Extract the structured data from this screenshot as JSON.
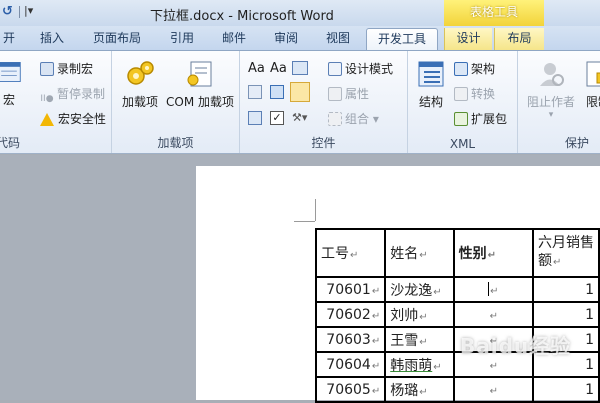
{
  "window": {
    "title": "下拉框.docx - Microsoft Word",
    "quick_access_more": "|▾",
    "context_group": "表格工具"
  },
  "tabs": [
    {
      "label": "开始"
    },
    {
      "label": "插入"
    },
    {
      "label": "页面布局"
    },
    {
      "label": "引用"
    },
    {
      "label": "邮件"
    },
    {
      "label": "审阅"
    },
    {
      "label": "视图"
    },
    {
      "label": "开发工具",
      "active": true
    },
    {
      "label": "设计",
      "context": true
    },
    {
      "label": "布局",
      "context": true
    }
  ],
  "ribbon": {
    "code": {
      "label": "代码",
      "macros": "宏",
      "record_macro": "录制宏",
      "pause_recording": "暂停录制",
      "macro_security": "宏安全性"
    },
    "addins": {
      "label": "加载项",
      "addins": "加载项",
      "com_addins": "COM 加载项"
    },
    "controls": {
      "label": "控件",
      "design_mode": "设计模式",
      "properties": "属性",
      "group": "组合"
    },
    "xml": {
      "label": "XML",
      "structure": "结构",
      "schema": "架构",
      "transform": "转换",
      "expansion_packs": "扩展包"
    },
    "protect": {
      "label": "保护",
      "block_authors": "阻止作者",
      "restrict_editing": "限制"
    }
  },
  "table": {
    "headers": [
      "工号",
      "姓名",
      "性别",
      "六月销售",
      "额"
    ],
    "rows": [
      {
        "id": "70601",
        "name": "沙龙逸"
      },
      {
        "id": "70602",
        "name": "刘帅"
      },
      {
        "id": "70603",
        "name": "王雪"
      },
      {
        "id": "70604",
        "name": "韩雨萌"
      },
      {
        "id": "70605",
        "name": "杨璐"
      }
    ],
    "paragraph_mark": "↵",
    "sales_digit": "1"
  },
  "watermark": "Baidu经验",
  "colors": {
    "accent": "#2b5ea8",
    "context_tab": "#f2d33a",
    "doc_background": "#a9b0ba"
  }
}
